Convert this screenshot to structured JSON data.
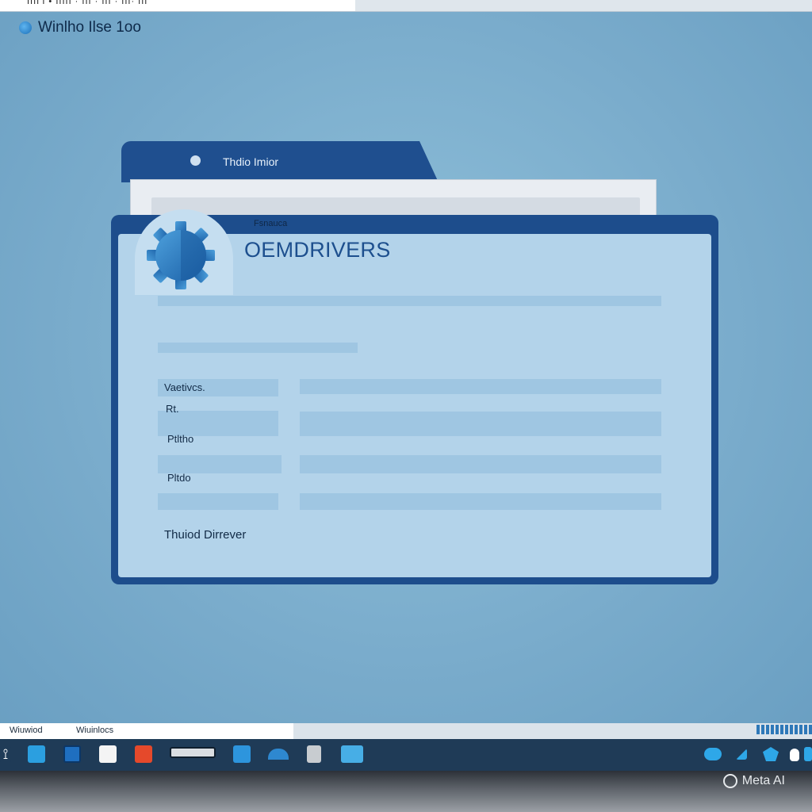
{
  "topbar": {
    "text": "IIII'I  •  IIIII  ·  III  ·  III  ·  III·  III"
  },
  "app": {
    "title": "Winlho Ilse 1oo"
  },
  "back_window": {
    "tab_label": "Thdio Imior"
  },
  "window": {
    "header_label": "Fsnauca",
    "title": "OEMDRIVERS",
    "rows": [
      {
        "label": "Vaetivcs."
      },
      {
        "label": "Rt."
      },
      {
        "label": "Ptltho"
      },
      {
        "label": "Pltdo"
      }
    ],
    "footer_label": "Thuiod Dirrever"
  },
  "strip": {
    "left_text_1": "Wiuwiod",
    "left_text_2": "Wiuinlocs"
  },
  "taskbar": {
    "icons": [
      {
        "name": "pin-icon",
        "color": "#ffffff"
      },
      {
        "name": "store-icon",
        "color": "#2b9fe0"
      },
      {
        "name": "grid-icon",
        "color": "#1f6fc0"
      },
      {
        "name": "notes-icon",
        "color": "#f4f4f4"
      },
      {
        "name": "office-icon",
        "color": "#e5492b"
      },
      {
        "name": "window-bar-icon",
        "color": "#d9dde1"
      },
      {
        "name": "explorer-icon",
        "color": "#2d95dd"
      },
      {
        "name": "edge-icon",
        "color": "#2e88d0"
      },
      {
        "name": "device-icon",
        "color": "#c8ccd0"
      },
      {
        "name": "terminal-icon",
        "color": "#47aee6"
      }
    ],
    "tray_icons": [
      {
        "name": "tray-chat-icon",
        "color": "#2ea7e8"
      },
      {
        "name": "tray-arrow-icon",
        "color": "#2ea7e8"
      },
      {
        "name": "tray-puzzle-icon",
        "color": "#2ea7e8"
      },
      {
        "name": "tray-drop-icon",
        "color": "#ffffff"
      },
      {
        "name": "tray-network-icon",
        "color": "#2ea7e8"
      }
    ]
  },
  "watermark": {
    "text": "Meta AI"
  }
}
